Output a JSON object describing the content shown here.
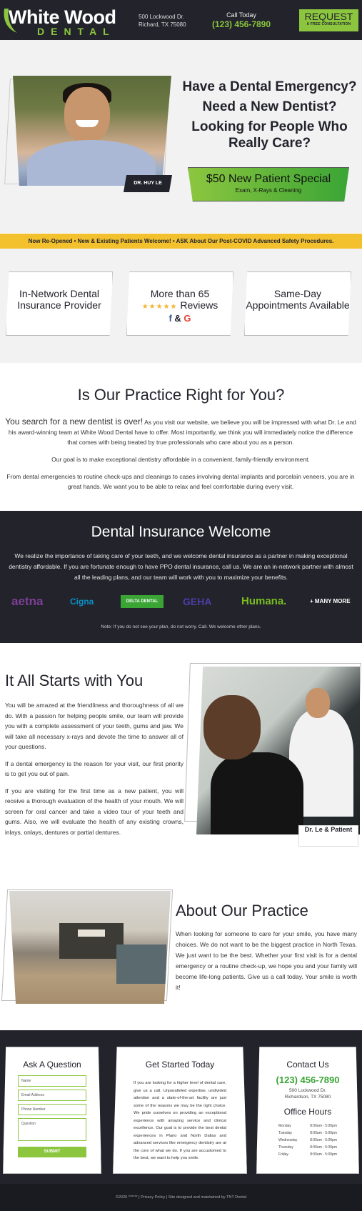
{
  "header": {
    "logo_top": "White Wood",
    "logo_bottom": "DENTAL",
    "address_line1": "500 Lockwood Dr.",
    "address_line2": "Richard, TX 75080",
    "call_label": "Call Today",
    "phone": "(123) 456-7890",
    "request_label": "REQUEST",
    "request_sub": "A FREE CONSULTATION",
    "accent_color": "#8cc63f"
  },
  "hero": {
    "photo_caption": "DR. HUY LE",
    "headline_1": "Have a Dental Emergency?",
    "headline_2": "Need a New Dentist?",
    "headline_3": "Looking for People Who Really Care?",
    "special_title": "$50 New Patient Special",
    "special_sub": "Exam, X-Rays & Cleaning"
  },
  "ribbon": "Now Re-Opened • New & Existing Patients Welcome! • ASK About Our Post-COVID Advanced Safety Procedures.",
  "badges": {
    "b1": "In-Network Dental Insurance Provider",
    "b2_line1": "More than 65",
    "b2_stars": "★★★★★",
    "b2_word": "Reviews",
    "b2_f": "f",
    "b2_amp": "&",
    "b2_g": "G",
    "b3": "Same-Day Appointments Available"
  },
  "right_for_you": {
    "heading": "Is Our Practice Right for You?",
    "lead": "You search for a new dentist is over!",
    "p1": " As you visit our website, we believe you will be impressed with what Dr. Le and his award-winning team at White Wood Dental have to offer. Most importantly, we think you will immediately notice the difference that comes with being treated by true professionals who care about you as a person.",
    "p2": "Our goal is to make exceptional dentistry affordable in a convenient, family-friendly environment.",
    "p3": "From dental emergencies to routine check-ups and cleanings to cases involving dental implants and porcelain veneers, you are in great hands. We want you to be able to relax and feel comfortable during every visit."
  },
  "insurance": {
    "heading": "Dental Insurance Welcome",
    "body": "We realize the importance of taking care of your teeth, and we welcome dental insurance as a partner in making exceptional dentistry affordable. If you are fortunate enough to have PPO dental insurance, call us. We are an in-network partner with almost all the leading plans, and our team will work with you to maximize your benefits.",
    "logos": [
      "aetna",
      "Cigna",
      "DELTA DENTAL",
      "GEHA",
      "Humana.",
      "+ MANY MORE"
    ],
    "note": "Note: If you do not see your plan, do not worry. Call. We welcome other plans."
  },
  "starts": {
    "heading": "It All Starts with You",
    "p1": "You will be amazed at the friendliness and thoroughness of all we do. With a passion for helping people smile, our team will provide you with a complete assessment of your teeth, gums and jaw. We will take all necessary x-rays and devote the time to answer all of your questions.",
    "p2": "If a dental emergency is the reason for your visit, our first priority is to get you out of pain.",
    "p3": "If you are visiting for the first time as a new patient, you will receive a thorough evaluation of the health of your mouth. We will screen for oral cancer and take a video tour of your teeth and gums. Also, we will evaluate the health of any existing crowns, inlays, onlays, dentures or partial dentures.",
    "caption": "Dr. Le & Patient"
  },
  "about": {
    "heading": "About Our Practice",
    "body": "When looking for someone to care for your smile, you have many choices. We do not want to be the biggest practice in North Texas. We just want to be the best. Whether your first visit is for a dental emergency or a routine check-up, we hope you and your family will become life-long patients. Give us a call today. Your smile is worth it!"
  },
  "footer": {
    "ask_heading": "Ask A Question",
    "name_ph": "Name",
    "email_ph": "Email Address",
    "phone_ph": "Phone Number",
    "question_ph": "Question",
    "submit": "SUBMIT",
    "gs_heading": "Get Started Today",
    "gs_body": "If you are looking for a higher level of dental care, give us a call. Unparalleled expertise, undivided attention and a state-of-the-art facility are just some of the reasons we may be the right choice. We pride ourselves on providing an exceptional experience with amazing service and clinical excellence. Our goal is to provide the best dental experiences in Plano and North Dallas and advanced services like emergency dentistry are at the core of what we do. If you are accustomed to the best, we want to help you smile.",
    "contact_heading": "Contact Us",
    "contact_phone": "(123) 456-7890",
    "contact_addr1": "500 Lockwood Dr.",
    "contact_addr2": "Richardson, TX 75080",
    "hours_heading": "Office Hours",
    "hours": [
      {
        "day": "Monday",
        "time": "8:00am - 5:00pm"
      },
      {
        "day": "Tuesday",
        "time": "8:00am - 5:00pm"
      },
      {
        "day": "Wednesday",
        "time": "8:00am - 5:00pm"
      },
      {
        "day": "Thursday",
        "time": "8:00am - 5:00pm"
      },
      {
        "day": "Friday",
        "time": "8:00am - 5:00pm"
      }
    ],
    "copyright": "©2020 ****** | Privacy Policy | Site designed and maintained by TNT Dental"
  }
}
